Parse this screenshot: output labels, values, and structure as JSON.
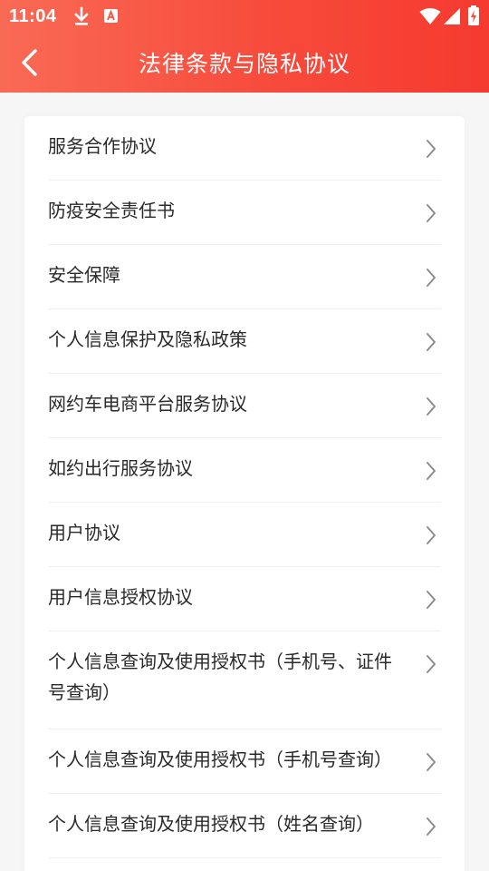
{
  "status_bar": {
    "time": "11:04",
    "icons": [
      "download-icon",
      "notification-a-icon",
      "wifi-icon",
      "signal-icon",
      "battery-charging-icon"
    ]
  },
  "nav": {
    "title": "法律条款与隐私协议",
    "back_icon": "chevron-left-icon"
  },
  "items": [
    {
      "label": "服务合作协议"
    },
    {
      "label": "防疫安全责任书"
    },
    {
      "label": "安全保障"
    },
    {
      "label": "个人信息保护及隐私政策"
    },
    {
      "label": "网约车电商平台服务协议"
    },
    {
      "label": "如约出行服务协议"
    },
    {
      "label": "用户协议"
    },
    {
      "label": "用户信息授权协议"
    },
    {
      "label": "个人信息查询及使用授权书（手机号、证件号查询）"
    },
    {
      "label": "个人信息查询及使用授权书（手机号查询）"
    },
    {
      "label": "个人信息查询及使用授权书（姓名查询）"
    }
  ],
  "colors": {
    "header_start": "#f96a55",
    "header_end": "#f53a30",
    "text": "#2a2a2a",
    "chevron": "#8c8c8c"
  }
}
